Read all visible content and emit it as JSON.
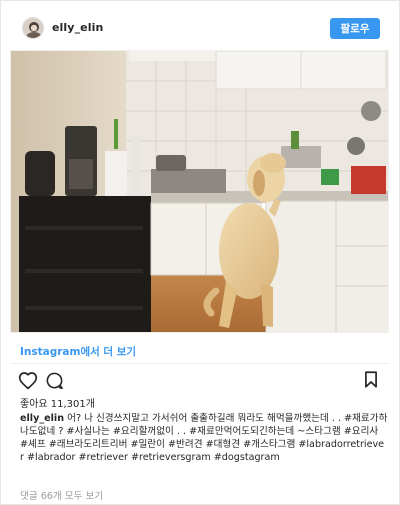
{
  "header": {
    "username": "elly_elin",
    "follow_label": "팔로우"
  },
  "view_link": "Instagram에서 더 보기",
  "likes_text": "좋아요 11,301개",
  "caption": {
    "author": "elly_elin",
    "text": " 어? 나 신경쓰지말고 가서쉬어 출출하길래 뭐라도 해먹을까했는데 . . #재료가하나도없네 ? #사실나는 #요리할꺼없이 . . #재료만먹어도되긴하는데 ~스타그램 #요리사 #셰프 #래브라도리트리버 #밀란이 #반려견 #대형견 #개스타그램 #labradorretriever #labrador #retriever #retrieversgram #dogstagram"
  },
  "comments_link": "댓글 66개 모두 보기",
  "icons": {
    "heart": "heart-icon",
    "comment": "comment-icon",
    "bookmark": "bookmark-icon"
  },
  "colors": {
    "accent": "#3897f0",
    "muted": "#999999",
    "text": "#262626"
  }
}
